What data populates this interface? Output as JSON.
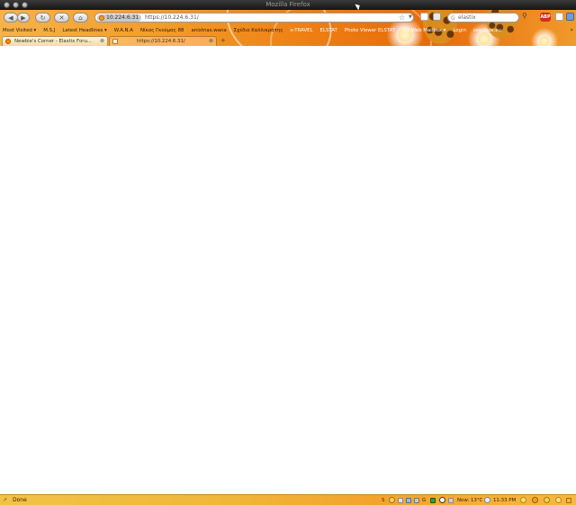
{
  "window": {
    "title": "Mozilla Firefox"
  },
  "nav": {
    "back_glyph": "◀",
    "forward_glyph": "▶",
    "reload_glyph": "↻",
    "stop_glyph": "✕",
    "home_glyph": "⌂",
    "site_identity": "10.224.6.31",
    "url": "https://10.224.6.31/",
    "bookmark_star": "☆",
    "dropdown_glyph": "▼"
  },
  "search": {
    "engine_glyph": "G",
    "query": "elastix",
    "button_glyph": "⚲"
  },
  "addons": {
    "adblock_label": "ABP"
  },
  "bookmarks": [
    {
      "label": "Most Visited ▾"
    },
    {
      "label": "M.S.J"
    },
    {
      "label": "Latest Headlines ▾"
    },
    {
      "label": "W.A.N.A"
    },
    {
      "label": "Νίκος Γκούμας 88"
    },
    {
      "label": "anixtnas.wana"
    },
    {
      "label": "Σχέδιο Καλλικράτης"
    },
    {
      "label": "e-TRAVEL"
    },
    {
      "label": "ELSTAT"
    },
    {
      "label": "Photo Viewer ELSTAT"
    },
    {
      "label": "My Web Mailbox ▾"
    },
    {
      "label": "Login"
    },
    {
      "label": "seedbox.eu"
    }
  ],
  "bookmarks_more": "»",
  "tabs": [
    {
      "label": "Newbie's Corner - Elastix Foru...",
      "close": "⊗"
    },
    {
      "label": "https://10.224.6.31/",
      "close": "⊗"
    }
  ],
  "new_tab_glyph": "+",
  "status": {
    "text": "Done",
    "icon_glyph": "↗",
    "weather": "Now: 13°C",
    "time": "11:33 PM",
    "tray_labels": [
      "S",
      "G"
    ]
  },
  "colors": {
    "theme_orange": "#ee7d12",
    "status_yellow": "#f1c347",
    "adblock_red": "#d82a1e"
  }
}
